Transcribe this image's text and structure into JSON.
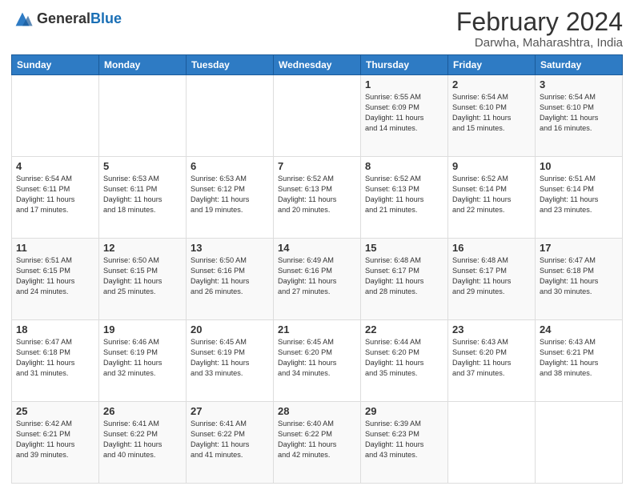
{
  "header": {
    "logo_general": "General",
    "logo_blue": "Blue",
    "month_title": "February 2024",
    "location": "Darwha, Maharashtra, India"
  },
  "days_of_week": [
    "Sunday",
    "Monday",
    "Tuesday",
    "Wednesday",
    "Thursday",
    "Friday",
    "Saturday"
  ],
  "weeks": [
    [
      {
        "day": "",
        "info": ""
      },
      {
        "day": "",
        "info": ""
      },
      {
        "day": "",
        "info": ""
      },
      {
        "day": "",
        "info": ""
      },
      {
        "day": "1",
        "info": "Sunrise: 6:55 AM\nSunset: 6:09 PM\nDaylight: 11 hours\nand 14 minutes."
      },
      {
        "day": "2",
        "info": "Sunrise: 6:54 AM\nSunset: 6:10 PM\nDaylight: 11 hours\nand 15 minutes."
      },
      {
        "day": "3",
        "info": "Sunrise: 6:54 AM\nSunset: 6:10 PM\nDaylight: 11 hours\nand 16 minutes."
      }
    ],
    [
      {
        "day": "4",
        "info": "Sunrise: 6:54 AM\nSunset: 6:11 PM\nDaylight: 11 hours\nand 17 minutes."
      },
      {
        "day": "5",
        "info": "Sunrise: 6:53 AM\nSunset: 6:11 PM\nDaylight: 11 hours\nand 18 minutes."
      },
      {
        "day": "6",
        "info": "Sunrise: 6:53 AM\nSunset: 6:12 PM\nDaylight: 11 hours\nand 19 minutes."
      },
      {
        "day": "7",
        "info": "Sunrise: 6:52 AM\nSunset: 6:13 PM\nDaylight: 11 hours\nand 20 minutes."
      },
      {
        "day": "8",
        "info": "Sunrise: 6:52 AM\nSunset: 6:13 PM\nDaylight: 11 hours\nand 21 minutes."
      },
      {
        "day": "9",
        "info": "Sunrise: 6:52 AM\nSunset: 6:14 PM\nDaylight: 11 hours\nand 22 minutes."
      },
      {
        "day": "10",
        "info": "Sunrise: 6:51 AM\nSunset: 6:14 PM\nDaylight: 11 hours\nand 23 minutes."
      }
    ],
    [
      {
        "day": "11",
        "info": "Sunrise: 6:51 AM\nSunset: 6:15 PM\nDaylight: 11 hours\nand 24 minutes."
      },
      {
        "day": "12",
        "info": "Sunrise: 6:50 AM\nSunset: 6:15 PM\nDaylight: 11 hours\nand 25 minutes."
      },
      {
        "day": "13",
        "info": "Sunrise: 6:50 AM\nSunset: 6:16 PM\nDaylight: 11 hours\nand 26 minutes."
      },
      {
        "day": "14",
        "info": "Sunrise: 6:49 AM\nSunset: 6:16 PM\nDaylight: 11 hours\nand 27 minutes."
      },
      {
        "day": "15",
        "info": "Sunrise: 6:48 AM\nSunset: 6:17 PM\nDaylight: 11 hours\nand 28 minutes."
      },
      {
        "day": "16",
        "info": "Sunrise: 6:48 AM\nSunset: 6:17 PM\nDaylight: 11 hours\nand 29 minutes."
      },
      {
        "day": "17",
        "info": "Sunrise: 6:47 AM\nSunset: 6:18 PM\nDaylight: 11 hours\nand 30 minutes."
      }
    ],
    [
      {
        "day": "18",
        "info": "Sunrise: 6:47 AM\nSunset: 6:18 PM\nDaylight: 11 hours\nand 31 minutes."
      },
      {
        "day": "19",
        "info": "Sunrise: 6:46 AM\nSunset: 6:19 PM\nDaylight: 11 hours\nand 32 minutes."
      },
      {
        "day": "20",
        "info": "Sunrise: 6:45 AM\nSunset: 6:19 PM\nDaylight: 11 hours\nand 33 minutes."
      },
      {
        "day": "21",
        "info": "Sunrise: 6:45 AM\nSunset: 6:20 PM\nDaylight: 11 hours\nand 34 minutes."
      },
      {
        "day": "22",
        "info": "Sunrise: 6:44 AM\nSunset: 6:20 PM\nDaylight: 11 hours\nand 35 minutes."
      },
      {
        "day": "23",
        "info": "Sunrise: 6:43 AM\nSunset: 6:20 PM\nDaylight: 11 hours\nand 37 minutes."
      },
      {
        "day": "24",
        "info": "Sunrise: 6:43 AM\nSunset: 6:21 PM\nDaylight: 11 hours\nand 38 minutes."
      }
    ],
    [
      {
        "day": "25",
        "info": "Sunrise: 6:42 AM\nSunset: 6:21 PM\nDaylight: 11 hours\nand 39 minutes."
      },
      {
        "day": "26",
        "info": "Sunrise: 6:41 AM\nSunset: 6:22 PM\nDaylight: 11 hours\nand 40 minutes."
      },
      {
        "day": "27",
        "info": "Sunrise: 6:41 AM\nSunset: 6:22 PM\nDaylight: 11 hours\nand 41 minutes."
      },
      {
        "day": "28",
        "info": "Sunrise: 6:40 AM\nSunset: 6:22 PM\nDaylight: 11 hours\nand 42 minutes."
      },
      {
        "day": "29",
        "info": "Sunrise: 6:39 AM\nSunset: 6:23 PM\nDaylight: 11 hours\nand 43 minutes."
      },
      {
        "day": "",
        "info": ""
      },
      {
        "day": "",
        "info": ""
      }
    ]
  ]
}
